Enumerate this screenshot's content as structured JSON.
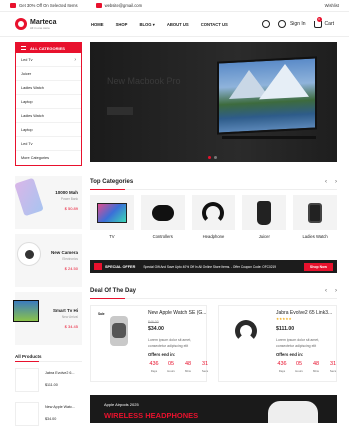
{
  "topbar": {
    "promo": "Get 30% Off On Selected Items",
    "email": "website@gmail.com",
    "wishlist": "Wishlist"
  },
  "header": {
    "logo_name": "Marteca",
    "logo_tag": "All in one store",
    "nav": [
      "HOME",
      "SHOP",
      "BLOG",
      "ABOUT US",
      "CONTACT US"
    ],
    "signin": "Sign In",
    "cart": "Cart",
    "cart_count": "0"
  },
  "categories": {
    "title": "ALL CATEGORIES",
    "items": [
      "Led Tv",
      "Juicer",
      "Ladies Watch",
      "Laptop",
      "Ladies Watch",
      "Laptop",
      "Led Tv",
      "More Categories"
    ]
  },
  "hero": {
    "title": "New Macbook Pro"
  },
  "side_cards": [
    {
      "title": "10000 Mah",
      "sub": "Power Bank",
      "price": "$ 50.89"
    },
    {
      "title": "New Camera",
      "sub": "Electronics",
      "price": "$ 24.50"
    },
    {
      "title": "Smart Tv Hi",
      "sub": "New Arrival",
      "price": "$ 34.45"
    }
  ],
  "all_products": {
    "title": "All Products",
    "items": [
      {
        "name": "Jabra Evolve2 6...",
        "price": "$111.00"
      },
      {
        "name": "New Apple Watc...",
        "price": "$34.00"
      }
    ]
  },
  "top_categories": {
    "title": "Top Categories",
    "items": [
      "TV",
      "Controllers",
      "Headphone",
      "Juicer",
      "Ladies Watch"
    ]
  },
  "banner": {
    "special": "SPECIAL OFFER",
    "message": "Special Gift And Save Upto 40% Off In All Online Store Items. - Offer Coupon Code: OFC0219",
    "shop": "Shop Now"
  },
  "deal": {
    "title": "Deal Of The Day",
    "items": [
      {
        "sale": "Sale",
        "name": "New Apple Watch SE (G...",
        "old": "$46.00",
        "new": "$34.00",
        "desc1": "Lorem ipsum dolor sit amet,",
        "desc2": "consectetur adipiscing elit",
        "ends": "Offers end in:",
        "d": "436",
        "h": "05",
        "m": "48",
        "s": "31",
        "du": "Days",
        "hu": "Hours",
        "mu": "Mins",
        "su": "Secs"
      },
      {
        "name": "Jabra Evolve2 65 Link3...",
        "stars": "★★★★★",
        "new": "$111.00",
        "desc1": "Lorem ipsum dolor sit amet,",
        "desc2": "consectetur adipiscing elit",
        "ends": "Offers end in:",
        "d": "436",
        "h": "05",
        "m": "48",
        "s": "31",
        "du": "Days",
        "hu": "Hours",
        "mu": "Mins",
        "su": "Secs"
      }
    ]
  },
  "bottom_banner": {
    "small": "Apple Airpods 2025",
    "big": "WIRELESS HEADPHONES"
  }
}
